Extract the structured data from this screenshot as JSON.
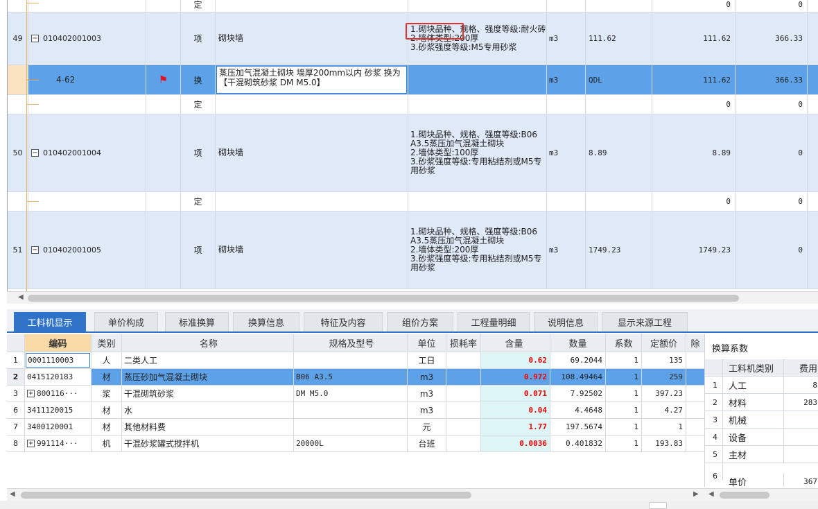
{
  "upper_rows": [
    {
      "kind": "ding",
      "type": "定",
      "qty": "0",
      "price": "0"
    },
    {
      "kind": "item",
      "no": "49",
      "code": "010402001003",
      "type": "项",
      "name": "砌块墙",
      "feature": "1.砌块品种、规格、强度等级:耐火砖\n2.墙体类型:200厚\n3.砂浆强度等级:M5专用砂浆",
      "unit": "m3",
      "qexp": "111.62",
      "qty": "111.62",
      "price": "366.33"
    },
    {
      "kind": "sel",
      "code": "4-62",
      "type": "换",
      "name": "蒸压加气混凝土砌块 墙厚200mm以内 砂浆  换为【干混砌筑砂浆 DM M5.0】",
      "unit": "m3",
      "qexp": "QDL",
      "qty": "111.62",
      "price": "366.33"
    },
    {
      "kind": "ding",
      "type": "定",
      "qty": "0",
      "price": "0"
    },
    {
      "kind": "item",
      "no": "50",
      "code": "010402001004",
      "type": "项",
      "name": "砌块墙",
      "feature": "1.砌块品种、规格、强度等级:B06 A3.5蒸压加气混凝土砌块\n2.墙体类型:100厚\n3.砂浆强度等级:专用粘结剂或M5专用砂浆",
      "unit": "m3",
      "qexp": "8.89",
      "qty": "8.89",
      "price": "0"
    },
    {
      "kind": "ding",
      "type": "定",
      "qty": "0",
      "price": "0"
    },
    {
      "kind": "item",
      "no": "51",
      "code": "010402001005",
      "type": "项",
      "name": "砌块墙",
      "feature": "1.砌块品种、规格、强度等级:B06 A3.5蒸压加气混凝土砌块\n2.墙体类型:200厚\n3.砂浆强度等级:专用粘结剂或M5专用砂浆",
      "unit": "m3",
      "qexp": "1749.23",
      "qty": "1749.23",
      "price": "0"
    }
  ],
  "tabs": [
    "工料机显示",
    "单价构成",
    "标准换算",
    "换算信息",
    "特征及内容",
    "组价方案",
    "工程量明细",
    "说明信息",
    "显示来源工程"
  ],
  "lower_headers": {
    "code": "编码",
    "cat": "类别",
    "name": "名称",
    "spec": "规格及型号",
    "unit": "单位",
    "loss": "损耗率",
    "cont": "含量",
    "qty": "数量",
    "coef": "系数",
    "price": "定额价",
    "excl": "除"
  },
  "lower_rows": [
    {
      "no": "1",
      "code": "0001110003",
      "cat": "人",
      "name": "二类人工",
      "spec": "",
      "unit": "工日",
      "cont": "0.62",
      "qty": "69.2044",
      "coef": "1",
      "price": "135"
    },
    {
      "no": "2",
      "code": "0415120183",
      "cat": "材",
      "name": "蒸压砂加气混凝土砌块",
      "spec": "B06 A3.5",
      "unit": "m3",
      "cont": "0.972",
      "qty": "108.49464",
      "coef": "1",
      "price": "259"
    },
    {
      "no": "3",
      "code": "800116···",
      "cat": "浆",
      "name": "干混砌筑砂浆",
      "spec": "DM M5.0",
      "unit": "m3",
      "cont": "0.071",
      "qty": "7.92502",
      "coef": "1",
      "price": "397.23"
    },
    {
      "no": "6",
      "code": "3411120015",
      "cat": "材",
      "name": "水",
      "spec": "",
      "unit": "m3",
      "cont": "0.04",
      "qty": "4.4648",
      "coef": "1",
      "price": "4.27"
    },
    {
      "no": "7",
      "code": "3400120001",
      "cat": "材",
      "name": "其他材料费",
      "spec": "",
      "unit": "元",
      "cont": "1.77",
      "qty": "197.5674",
      "coef": "1",
      "price": "1"
    },
    {
      "no": "8",
      "code": "991114···",
      "cat": "机",
      "name": "干混砂浆罐式搅拌机",
      "spec": "20000L",
      "unit": "台班",
      "cont": "0.0036",
      "qty": "0.401832",
      "coef": "1",
      "price": "193.83"
    }
  ],
  "right_panel": {
    "title": "换算系数",
    "headers": {
      "cat": "工料机类别",
      "fee": "费用"
    },
    "rows": [
      {
        "no": "1",
        "cat": "人工",
        "fee": "8"
      },
      {
        "no": "2",
        "cat": "材料",
        "fee": "283"
      },
      {
        "no": "3",
        "cat": "机械",
        "fee": ""
      },
      {
        "no": "4",
        "cat": "设备",
        "fee": ""
      },
      {
        "no": "5",
        "cat": "主材",
        "fee": ""
      },
      {
        "no": "6",
        "cat": "单价",
        "fee": "367"
      }
    ]
  },
  "colors": {
    "selected_row": "#5da2e8",
    "item_row": "#dfe9f8",
    "tab_active": "#2f73c8",
    "highlight_box": "#e03030",
    "content_red": "#e00000"
  }
}
